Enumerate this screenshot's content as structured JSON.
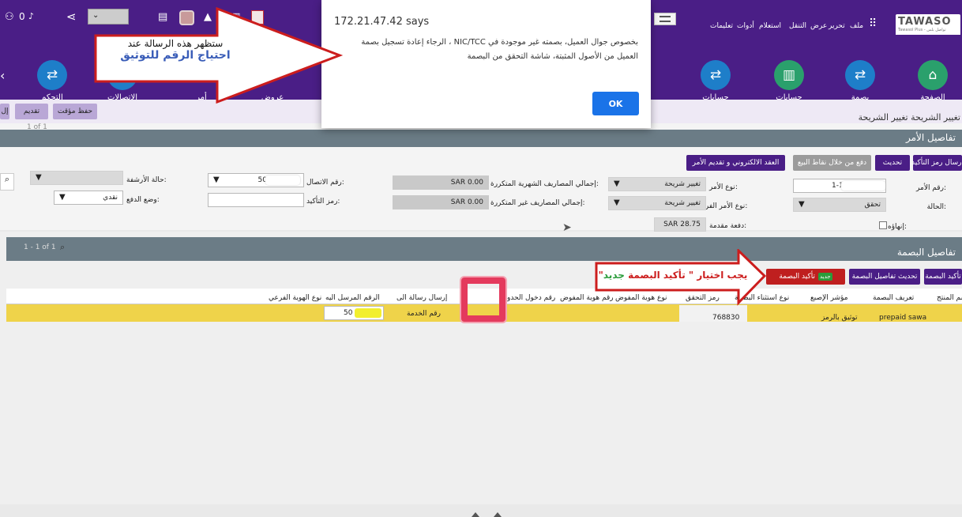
{
  "topbar": {
    "badge": "0",
    "brand": "TAWASO",
    "brand_sub": "Tawasol Plus - تواصل بلس",
    "menu": [
      "ملف",
      "تحرير",
      "عرض",
      "التنقل",
      "استعلام",
      "أدوات",
      "تعليمات"
    ]
  },
  "nav": {
    "items": [
      {
        "label": "الصفحة",
        "icon": "home-icon"
      },
      {
        "label": "بصمة",
        "icon": "fingerprint-icon"
      },
      {
        "label": "حسابات",
        "icon": "building-icon"
      },
      {
        "label": "حسابات",
        "icon": "accounts-icon"
      },
      {
        "label": "عروض",
        "icon": "offers-icon"
      },
      {
        "label": "أمر",
        "icon": "order-icon"
      },
      {
        "label": "الاتصالات",
        "icon": "communications-icon"
      },
      {
        "label": "التحكم",
        "icon": "control-icon"
      }
    ]
  },
  "toolbar": {
    "save_temp": "حفظ مؤقت",
    "submit": "تقديم",
    "small": "إل"
  },
  "breadcrumb": "تغيير الشريحة  تغيير الشريحة",
  "order_section": {
    "title": "تفاصيل الأمر",
    "pager": "1 of 1",
    "buttons": {
      "send_code": "إرسال رمز التأكيد",
      "update": "تحديث",
      "pay_pos": "دفع من خلال نقاط البيع",
      "contract": "العقد الالكتروني و تقديم الأمر"
    },
    "fields": {
      "order_no_label": "رقم الأمر:",
      "order_no": "1-12",
      "status_label": "الحالة:",
      "status": "تحقق",
      "end_label": "إنهاؤه:",
      "order_type_label": "نوع الأمر:",
      "order_type": "تغيير شريحة",
      "sub_type_label": "نوع الأمر الفرعي:",
      "sub_type": "تغيير شريحة",
      "prepay_label": "دفعة مقدمة:",
      "prepay": "SAR 28.75",
      "monthly_label": "إجمالي المصاريف الشهرية المتكررة:",
      "monthly": "SAR 0.00",
      "nonrec_label": "إجمالي المصاريف غير المتكررة:",
      "nonrec": "SAR 0.00",
      "contact_label": "رقم الاتصال:",
      "contact": "50",
      "confirm_label": "رمز التأكيد:",
      "confirm": "",
      "archive_label": "حالة الأرشفة:",
      "archive": "",
      "paymode_label": "وضع الدفع:",
      "paymode": "نقدي"
    }
  },
  "finger_section": {
    "title": "تفاصيل البصمة",
    "pager": "1 - 1 of 1",
    "buttons": {
      "confirm_small": "تأكيد البصمة",
      "update_details": "تحديث تفاصيل البصمة",
      "confirm": "تأكيد البصمة",
      "new_badge": "جديد"
    },
    "columns": [
      "اسم المنتج",
      "تعريف البصمة",
      "مؤشر الإصبع",
      "نوع استثناء البصمة",
      "رمز التحقق",
      "نوع هوية المفوض",
      "رقم هوية المفوض",
      "رقم دخول الحدود",
      "إرسال رسالة الى",
      "الرقم المرسل اليه",
      "نوع الهوية الفرعي"
    ],
    "row": {
      "product": "prepaid sawa",
      "fp_def": "توثيق بالرمز",
      "code": "768830",
      "send_to": "رقم الخدمة",
      "send_no": "50"
    }
  },
  "dialog": {
    "host": "172.21.47.42 says",
    "message": "بخصوص جوال العميل، بصمته غير موجودة في NIC/TCC ، الرجاء إعادة تسجيل بصمة العميل من الأصول المثبتة، شاشة التحقق من البصمة",
    "ok": "OK"
  },
  "annotations": {
    "left_line1": "ستظهر هذه الرسالة عند",
    "left_line2": "احتياج الرقم للتوثيق",
    "right_a": "يجب اختيار",
    "right_b": "\" تأكيد البصمة",
    "right_c": "جديد",
    "right_d": "\""
  },
  "colors": {
    "brand": "#4a1e86",
    "highlight": "#efd34a",
    "arrow_red": "#cc1d1d",
    "dialog_btn": "#1a73e8"
  }
}
